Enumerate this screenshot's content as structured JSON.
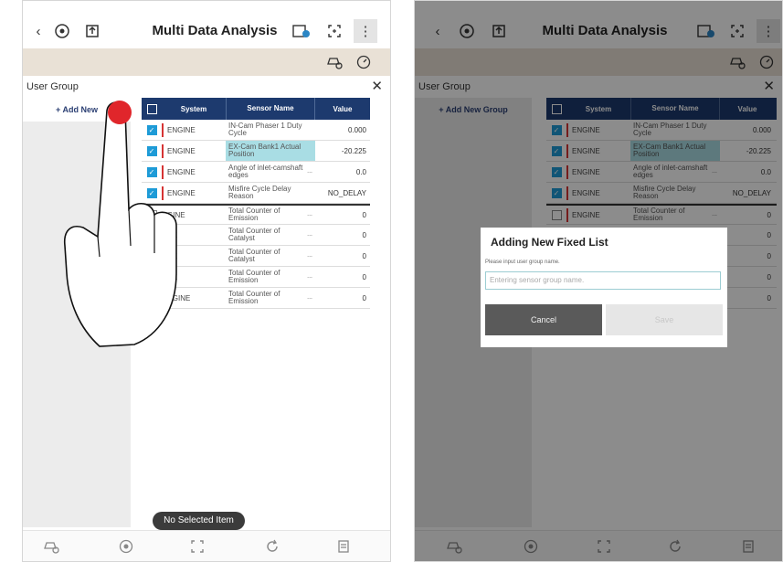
{
  "app": {
    "title": "Multi Data Analysis",
    "user_group_label": "User Group",
    "add_new_group_label": "+ Add New Group",
    "add_new_truncated": "+ Add New"
  },
  "table": {
    "headers": {
      "system": "System",
      "sensor": "Sensor Name",
      "value": "Value"
    },
    "rows": [
      {
        "system": "ENGINE",
        "sensor": "IN-Cam Phaser 1 Duty Cycle",
        "value": "0.000",
        "checked": true
      },
      {
        "system": "ENGINE",
        "sensor": "EX-Cam Bank1 Actual Position",
        "value": "-20.225",
        "checked": true,
        "highlighted": true
      },
      {
        "system": "ENGINE",
        "sensor": "Angle of inlet-camshaft edges",
        "value": "0.0",
        "checked": true
      },
      {
        "system": "ENGINE",
        "sensor": "Misfire Cycle Delay Reason",
        "value": "NO_DELAY",
        "checked": true
      },
      {
        "system": "ENGINE",
        "sensor": "Total Counter of Emission",
        "value": "0",
        "checked": false
      },
      {
        "system": "ENGINE",
        "sensor": "Total Counter of Catalyst",
        "value": "0",
        "checked": false
      },
      {
        "system": "ENGINE",
        "sensor": "Total Counter of Catalyst",
        "value": "0",
        "checked": false
      },
      {
        "system": "ENGINE",
        "sensor": "Total Counter of Emission",
        "value": "0",
        "checked": false
      },
      {
        "system": "ENGINE",
        "sensor": "Total Counter of Emission",
        "value": "0",
        "checked": false
      }
    ],
    "left_system_labels": [
      "ENGINE",
      "ENGINE",
      "ENGINE",
      "ENGINE",
      "GINE",
      "NE",
      "NE",
      "NE",
      "NGINE"
    ]
  },
  "toast": {
    "text": "No Selected Item"
  },
  "dialog": {
    "title": "Adding New Fixed List",
    "hint": "Please input user group name.",
    "placeholder": "Entering sensor group name.",
    "cancel_label": "Cancel",
    "save_label": "Save"
  },
  "icons": {
    "back": "back-arrow-icon",
    "vehicle_scan": "vehicle-scan-icon",
    "vehicle_upload": "vehicle-upload-icon",
    "calendar": "calendar-badge-icon",
    "fullscreen": "fullscreen-icon",
    "more": "more-vertical-icon",
    "car_settings": "car-settings-icon",
    "gauge": "gauge-icon"
  },
  "colors": {
    "header_bg": "#1d3a6e",
    "checkbox_on": "#1e9bd7",
    "system_bar": "#d63333",
    "highlight": "#a9dde4",
    "subbar": "#e9e1d6",
    "touch_dot": "#e0262b"
  }
}
